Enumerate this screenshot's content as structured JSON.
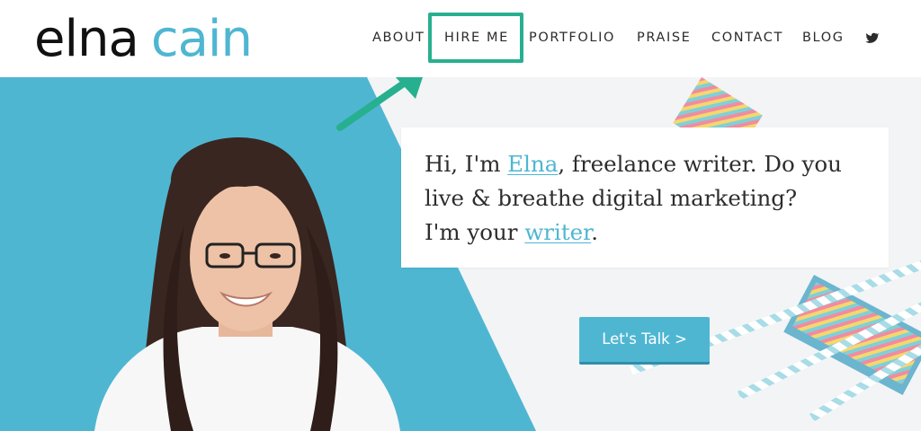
{
  "logo": {
    "first": "elna",
    "last": "cain"
  },
  "nav": {
    "items": [
      {
        "label": "ABOUT"
      },
      {
        "label": "HIRE ME"
      },
      {
        "label": "PORTFOLIO"
      },
      {
        "label": "PRAISE"
      },
      {
        "label": "CONTACT"
      },
      {
        "label": "BLOG"
      }
    ],
    "social_icon": "twitter-icon"
  },
  "hero": {
    "intro_parts": [
      "Hi, I'm ",
      "Elna",
      ", freelance writer. Do you live & breathe digital marketing?",
      "I'm your ",
      "writer",
      "."
    ],
    "cta_label": "Let's Talk >"
  },
  "colors": {
    "brand_blue": "#4fb6d2",
    "annotation_green": "#27b08f",
    "text_dark": "#2d2d2d"
  },
  "annotation": {
    "highlight_target": "HIRE ME",
    "arrow_icon": "arrow-up-right-icon"
  }
}
